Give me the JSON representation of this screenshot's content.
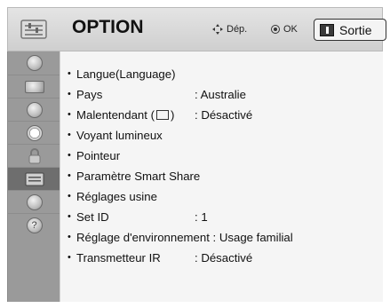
{
  "header": {
    "title": "OPTION",
    "nav_hint": "Dép.",
    "ok_hint": "OK",
    "exit_label": "Sortie"
  },
  "sidebar": {
    "items": [
      {
        "icon": "satellite-dish-icon",
        "active": false
      },
      {
        "icon": "screen-icon",
        "active": false
      },
      {
        "icon": "speaker-icon",
        "active": false
      },
      {
        "icon": "clock-icon",
        "active": false
      },
      {
        "icon": "lock-icon",
        "active": false
      },
      {
        "icon": "option-icon",
        "active": true
      },
      {
        "icon": "globe-icon",
        "active": false
      },
      {
        "icon": "help-icon",
        "active": false
      }
    ]
  },
  "menu": {
    "items": [
      {
        "label": "Langue(Language)",
        "value": ""
      },
      {
        "label": "Pays",
        "value": ": Australie"
      },
      {
        "label": "Malentendant (",
        "label_suffix": ")",
        "value": ": Désactivé"
      },
      {
        "label": "Voyant lumineux",
        "value": ""
      },
      {
        "label": "Pointeur",
        "value": ""
      },
      {
        "label": "Paramètre Smart Share",
        "value": ""
      },
      {
        "label": "Réglages usine",
        "value": ""
      },
      {
        "label": "Set ID",
        "value": ": 1"
      },
      {
        "label": "Réglage d'environnement : Usage familial",
        "value": ""
      },
      {
        "label": "Transmetteur IR",
        "value": ": Désactivé"
      }
    ]
  }
}
